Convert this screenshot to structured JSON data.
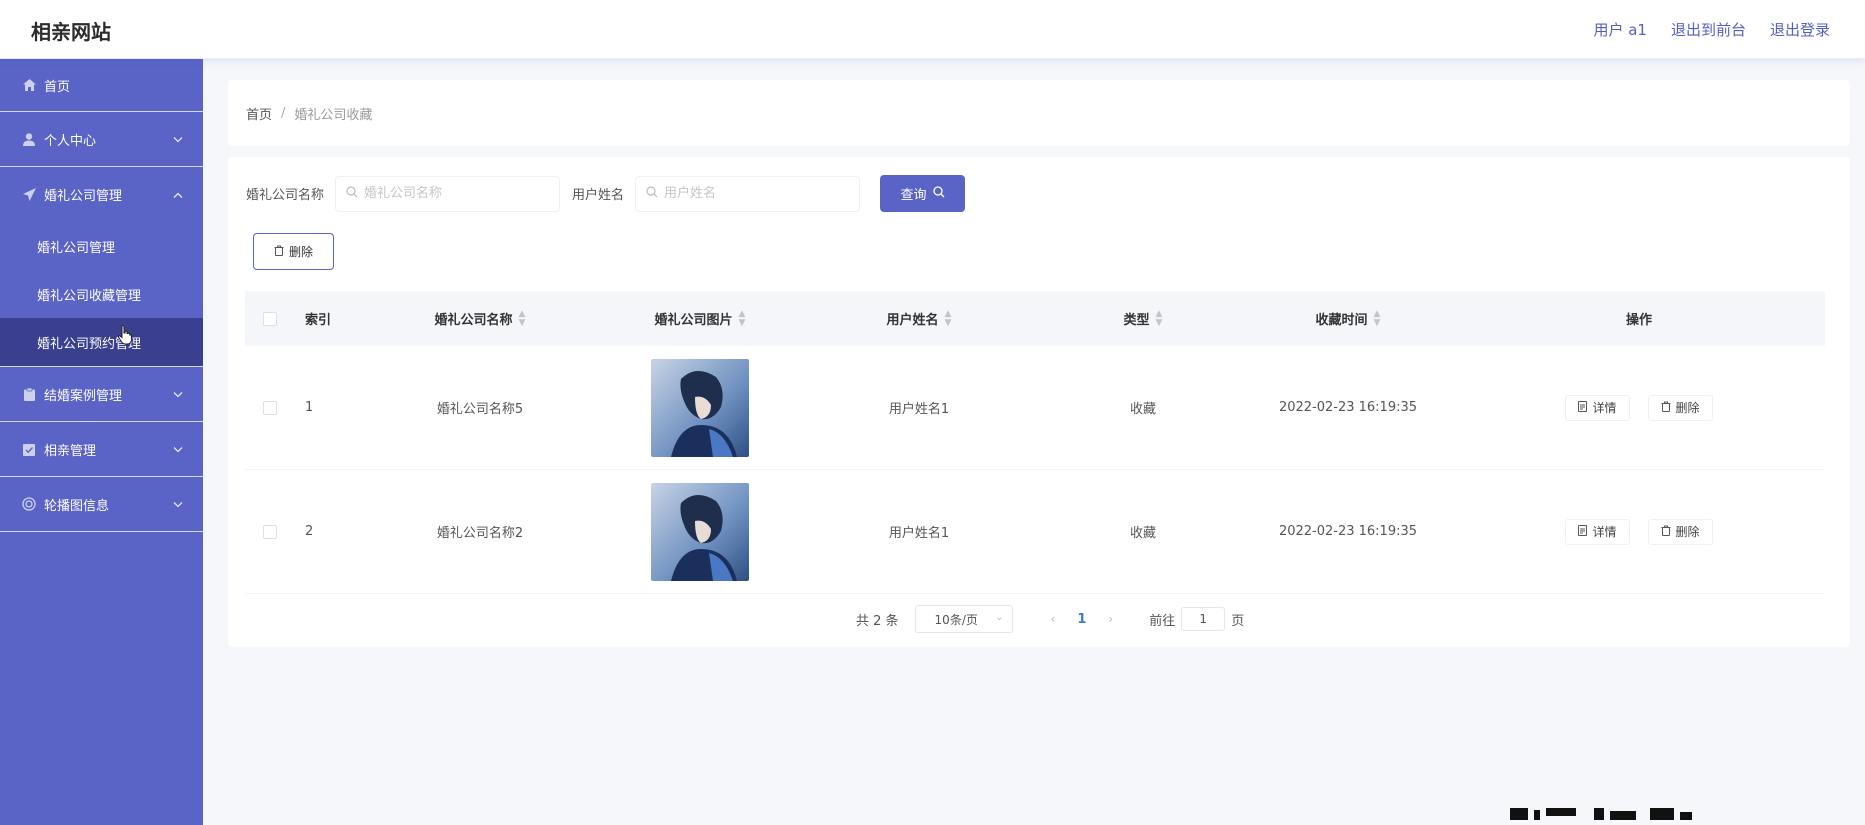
{
  "header": {
    "brand": "相亲网站",
    "links": [
      "用户 a1",
      "退出到前台",
      "退出登录"
    ]
  },
  "sidebar": {
    "items": [
      {
        "label": "首页",
        "icon": "home-icon"
      },
      {
        "label": "个人中心",
        "icon": "user-icon",
        "chevron": "down"
      },
      {
        "label": "婚礼公司管理",
        "icon": "send-icon",
        "chevron": "up",
        "expanded": true,
        "children": [
          {
            "label": "婚礼公司管理"
          },
          {
            "label": "婚礼公司收藏管理"
          },
          {
            "label": "婚礼公司预约管理",
            "active": true
          }
        ]
      },
      {
        "label": "结婚案例管理",
        "icon": "clipboard-icon",
        "chevron": "down"
      },
      {
        "label": "相亲管理",
        "icon": "check-doc-icon",
        "chevron": "down"
      },
      {
        "label": "轮播图信息",
        "icon": "target-icon",
        "chevron": "down"
      }
    ]
  },
  "breadcrumb": {
    "home": "首页",
    "separator": "/",
    "current": "婚礼公司收藏"
  },
  "search": {
    "company_label": "婚礼公司名称",
    "company_placeholder": "婚礼公司名称",
    "user_label": "用户姓名",
    "user_placeholder": "用户姓名",
    "query_label": "查询"
  },
  "toolbar": {
    "delete_label": "删除"
  },
  "table": {
    "headers": {
      "index": "索引",
      "company_name": "婚礼公司名称",
      "company_image": "婚礼公司图片",
      "user_name": "用户姓名",
      "type": "类型",
      "fav_time": "收藏时间",
      "actions": "操作"
    },
    "rows": [
      {
        "index": "1",
        "company_name": "婚礼公司名称5",
        "user_name": "用户姓名1",
        "type": "收藏",
        "fav_time": "2022-02-23 16:19:35",
        "detail_label": "详情",
        "delete_label": "删除"
      },
      {
        "index": "2",
        "company_name": "婚礼公司名称2",
        "user_name": "用户姓名1",
        "type": "收藏",
        "fav_time": "2022-02-23 16:19:35",
        "detail_label": "详情",
        "delete_label": "删除"
      }
    ]
  },
  "pagination": {
    "total": "共 2 条",
    "page_size": "10条/页",
    "current_page": "1",
    "goto_prefix": "前往",
    "goto_value": "1",
    "goto_suffix": "页"
  },
  "colors": {
    "primary": "#5a63c6",
    "sidebar_active": "#3a3f8f",
    "page_bg": "#f6f7fb",
    "link_blue": "#3a7bd5"
  }
}
